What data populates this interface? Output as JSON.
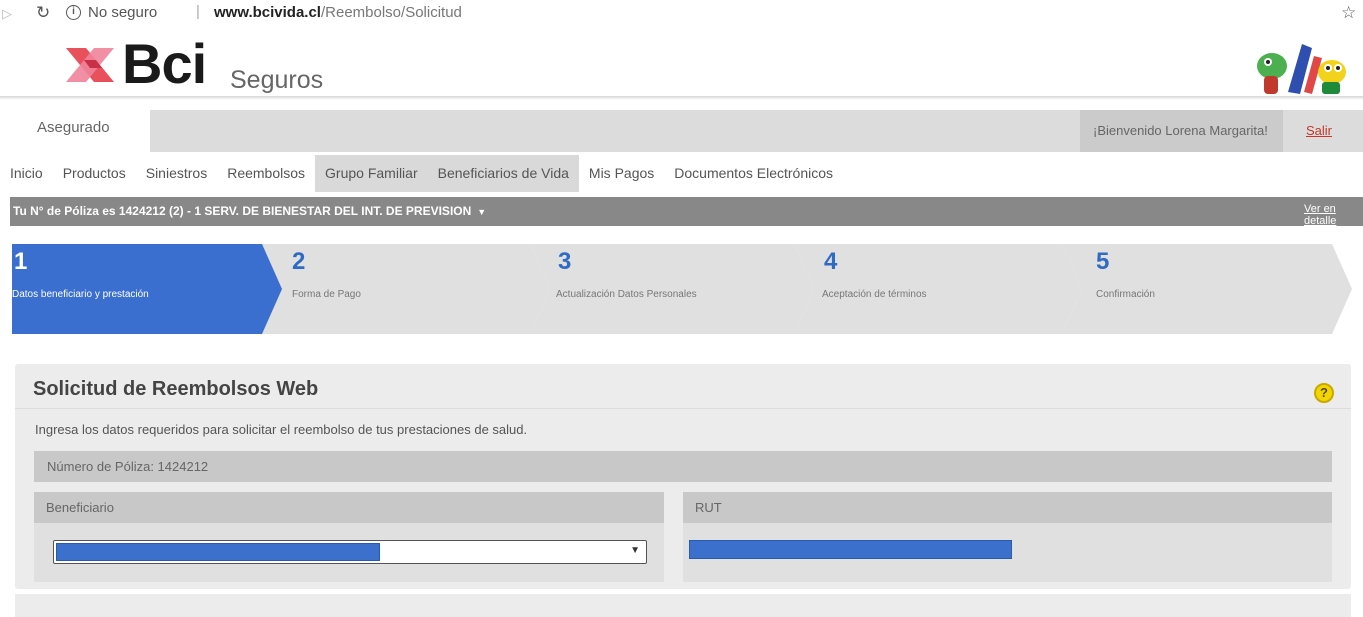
{
  "browser": {
    "security_label": "No seguro",
    "url_host": "www.bcivida.cl",
    "url_path": "/Reembolso/Solicitud"
  },
  "header": {
    "logo_text": "Bci",
    "logo_sub": "Seguros"
  },
  "user_bar": {
    "tab_label": "Asegurado",
    "welcome_text": "¡Bienvenido Lorena Margarita!",
    "logout_label": "Salir"
  },
  "nav": {
    "items": [
      {
        "label": "Inicio"
      },
      {
        "label": "Productos"
      },
      {
        "label": "Siniestros"
      },
      {
        "label": "Reembolsos"
      },
      {
        "label": "Grupo Familiar"
      },
      {
        "label": "Beneficiarios de Vida"
      },
      {
        "label": "Mis Pagos"
      },
      {
        "label": "Documentos Electrónicos"
      }
    ],
    "active_index": 4
  },
  "policy_bar": {
    "text": "Tu N° de Póliza es  1424212 (2) - 1 SERV. DE BIENESTAR DEL INT. DE PREVISION",
    "detail_link": "Ver en detalle"
  },
  "steps": [
    {
      "number": "1",
      "label": "Datos beneficiario y prestación",
      "active": true
    },
    {
      "number": "2",
      "label": "Forma de Pago",
      "active": false
    },
    {
      "number": "3",
      "label": "Actualización Datos Personales",
      "active": false
    },
    {
      "number": "4",
      "label": "Aceptación de términos",
      "active": false
    },
    {
      "number": "5",
      "label": "Confirmación",
      "active": false
    }
  ],
  "form": {
    "title": "Solicitud de Reembolsos Web",
    "help_icon": "?",
    "intro": "Ingresa los datos requeridos para solicitar el reembolso de tus prestaciones de salud.",
    "policy_number": "Número de Póliza: 1424212",
    "beneficiary_label": "Beneficiario",
    "rut_label": "RUT"
  },
  "colors": {
    "accent": "#2f6bc4",
    "active_step": "#3a6fcf",
    "step_inactive": "#e0e0e0",
    "policy_bar": "#888888",
    "help_icon": "#f2d600",
    "logout": "#c0392b"
  }
}
